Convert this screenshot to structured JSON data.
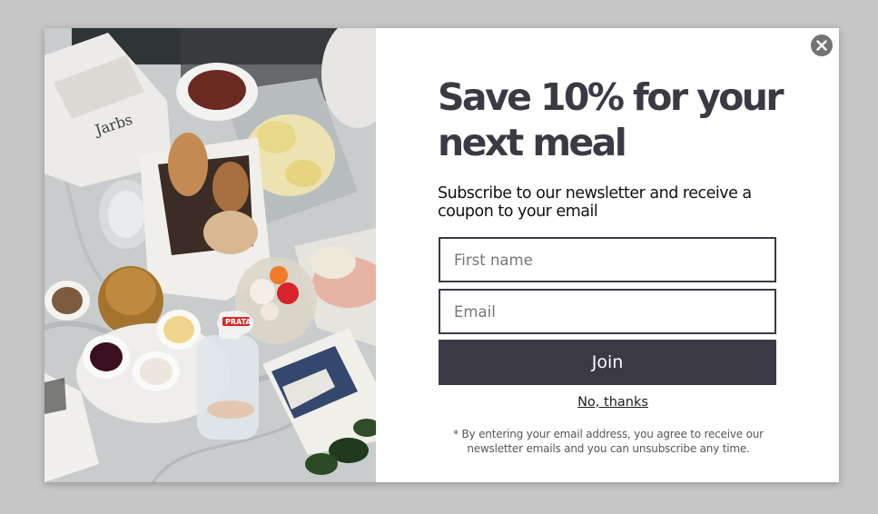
{
  "popup": {
    "close_icon": "close-icon",
    "photo_icon": "breakfast-table-photo",
    "headline": "Save 10% for your next meal",
    "subheadline": "Subscribe to our newsletter and receive a coupon to your email",
    "first_name_placeholder": "First name",
    "first_name_value": "",
    "email_placeholder": "Email",
    "email_value": "",
    "join_label": "Join",
    "dismiss_label": "No, thanks",
    "disclaimer": "* By entering your email address, you agree to receive our newsletter emails and you can unsubscribe any time.",
    "photo_text": {
      "bag_logo": "Jarbs",
      "bottle_brand": "PRATA"
    }
  },
  "colors": {
    "overlay": "#c6c6c6",
    "accent": "#3b3a44",
    "close_button": "#737373",
    "panel": "#ffffff"
  }
}
